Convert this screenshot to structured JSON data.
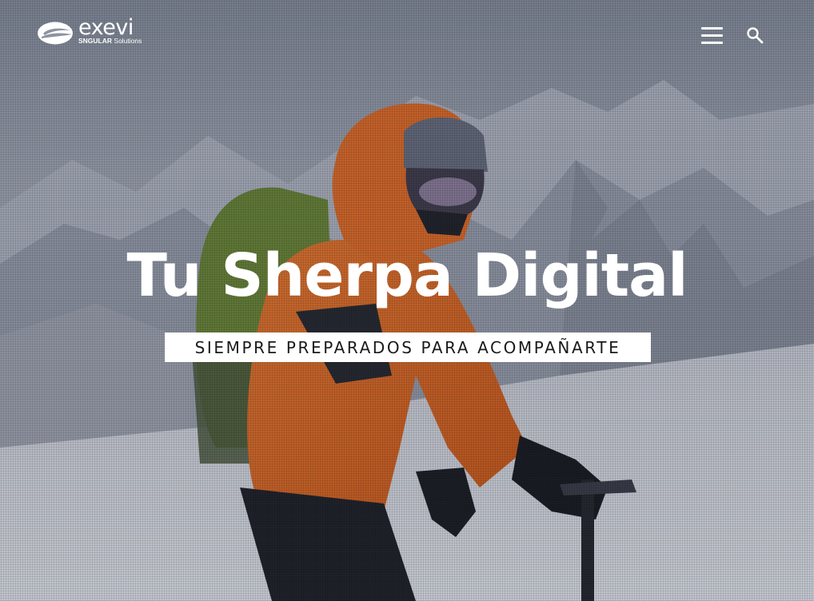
{
  "brand": {
    "logo_text": "exevi",
    "logo_sub_bold": "SNGULAR",
    "logo_sub_light": "Solutions"
  },
  "header": {
    "menu_icon": "hamburger-menu-icon",
    "search_icon": "search-icon"
  },
  "hero": {
    "title": "Tu Sherpa Digital",
    "tagline": "SIEMPRE PREPARADOS PARA ACOMPAÑARTE",
    "background_image": "mountaineer-in-orange-jacket-on-snowy-mountain"
  },
  "colors": {
    "text": "#ffffff",
    "tagline_bg": "#ffffff",
    "tagline_text": "#1a1a1a",
    "jacket": "#f07020"
  }
}
